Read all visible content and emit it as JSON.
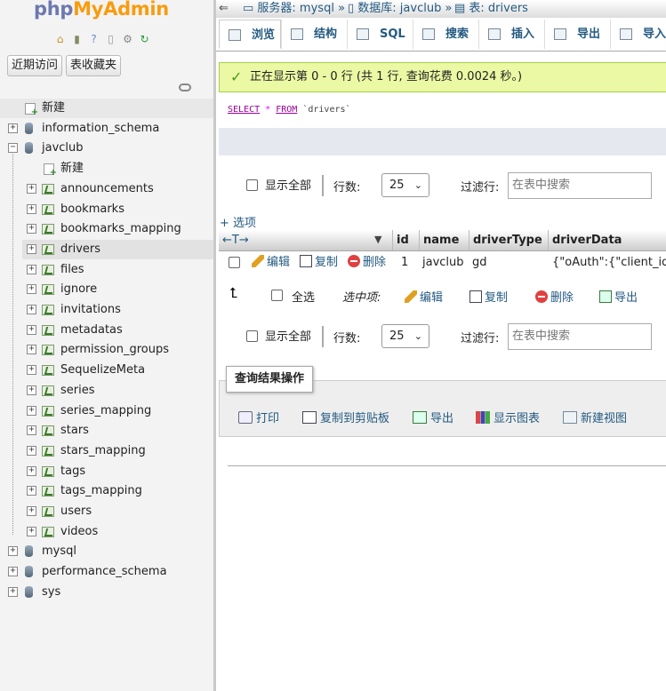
{
  "nav": {
    "logo_php": "php",
    "logo_admin": "MyAdmin",
    "recent_btn": "近期访问",
    "favorites_btn": "表收藏夹",
    "icons": [
      "home-icon",
      "log-out-icon",
      "help-icon",
      "docs-icon",
      "settings-icon",
      "reload-icon"
    ],
    "tree": {
      "new": "新建",
      "databases": [
        {
          "name": "information_schema"
        },
        {
          "name": "javclub",
          "children_new": "新建",
          "tables": [
            "announcements",
            "bookmarks",
            "bookmarks_mapping",
            "drivers",
            "files",
            "ignore",
            "invitations",
            "metadatas",
            "permission_groups",
            "SequelizeMeta",
            "series",
            "series_mapping",
            "stars",
            "stars_mapping",
            "tags",
            "tags_mapping",
            "users",
            "videos"
          ]
        },
        {
          "name": "mysql"
        },
        {
          "name": "performance_schema"
        },
        {
          "name": "sys"
        }
      ],
      "selected_table": "drivers"
    }
  },
  "breadcrumb": {
    "back": "⇐",
    "server": "服务器: mysql",
    "database": "数据库: javclub",
    "table": "表: drivers",
    "sep": "»"
  },
  "tabs": [
    "浏览",
    "结构",
    "SQL",
    "搜索",
    "插入",
    "导出",
    "导入"
  ],
  "message": {
    "text": "正在显示第 0 - 0 行 (共 1 行, 查询花费 0.0024 秒。)"
  },
  "sql": {
    "select": "SELECT",
    "star": "*",
    "from": "FROM",
    "table": "`drivers`"
  },
  "pager": {
    "show_all": "显示全部",
    "rows_label": "行数:",
    "rows_value": "25",
    "filter_label": "过滤行:",
    "filter_placeholder": "在表中搜索"
  },
  "options_link": "+ 选项",
  "table": {
    "sort_arrows": "←T→",
    "columns": [
      "id",
      "name",
      "driverType",
      "driverData"
    ],
    "rows": [
      {
        "id": "1",
        "name": "javclub",
        "driverType": "gd",
        "driverData": "{\"oAuth\":{\"client_id\":"
      }
    ],
    "row_actions": {
      "edit": "编辑",
      "copy": "复制",
      "delete": "删除"
    }
  },
  "bulk": {
    "check_all": "全选",
    "with_selected": "选中项:",
    "edit": "编辑",
    "copy": "复制",
    "delete": "删除",
    "export": "导出"
  },
  "query_ops": {
    "legend": "查询结果操作",
    "print": "打印",
    "copy_clipboard": "复制到剪贴板",
    "export": "导出",
    "chart": "显示图表",
    "create_view": "新建视图"
  },
  "colors": {
    "link": "#235a81",
    "success_bg": "#ebf8a4",
    "logo_php": "#6c78af",
    "logo_admin": "#f89c0e"
  }
}
